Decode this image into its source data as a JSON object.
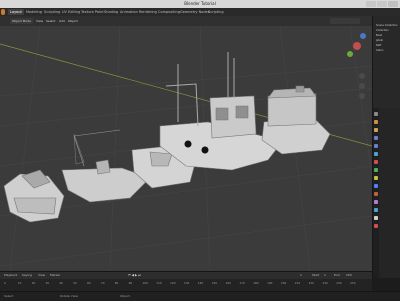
{
  "window": {
    "title": "Blender Tutorial"
  },
  "workspaces": [
    {
      "label": "Layout",
      "active": true
    },
    {
      "label": "Modeling"
    },
    {
      "label": "Sculpting"
    },
    {
      "label": "UV Editing"
    },
    {
      "label": "Texture Paint"
    },
    {
      "label": "Shading"
    },
    {
      "label": "Animation"
    },
    {
      "label": "Rendering"
    },
    {
      "label": "Compositing"
    },
    {
      "label": "Geometry Nodes"
    },
    {
      "label": "Scripting"
    }
  ],
  "header": {
    "mode": "Object Mode",
    "view": "View",
    "select": "Select",
    "add": "Add",
    "object": "Object",
    "select_box": "Select Box"
  },
  "outliner": {
    "items": [
      "Scene Collection",
      "Collection",
      "Boat",
      "Jetski",
      "Raft",
      "Cabin"
    ]
  },
  "properties": {
    "tab_colors": [
      "#8a8a8a",
      "#d09040",
      "#d0a060",
      "#6a7fd0",
      "#6a7fd0",
      "#4fa0d0",
      "#d05050",
      "#50b060",
      "#c0c040",
      "#5080ff",
      "#c06040",
      "#b080d0",
      "#4fa0d0",
      "#d0d0d0",
      "#d05050"
    ]
  },
  "timeline": {
    "playback": "Playback",
    "keying": "Keying",
    "view": "View",
    "marker": "Marker",
    "current_frame": "1",
    "start_label": "Start",
    "start": "1",
    "end_label": "End",
    "end": "250",
    "ruler": [
      "0",
      "10",
      "20",
      "30",
      "40",
      "50",
      "60",
      "70",
      "80",
      "90",
      "100",
      "110",
      "120",
      "130",
      "140",
      "150",
      "160",
      "170",
      "180",
      "190",
      "200",
      "210",
      "220",
      "230",
      "240",
      "250"
    ]
  },
  "status": {
    "left": "Select",
    "middle": "Rotate View",
    "right": "Object"
  }
}
